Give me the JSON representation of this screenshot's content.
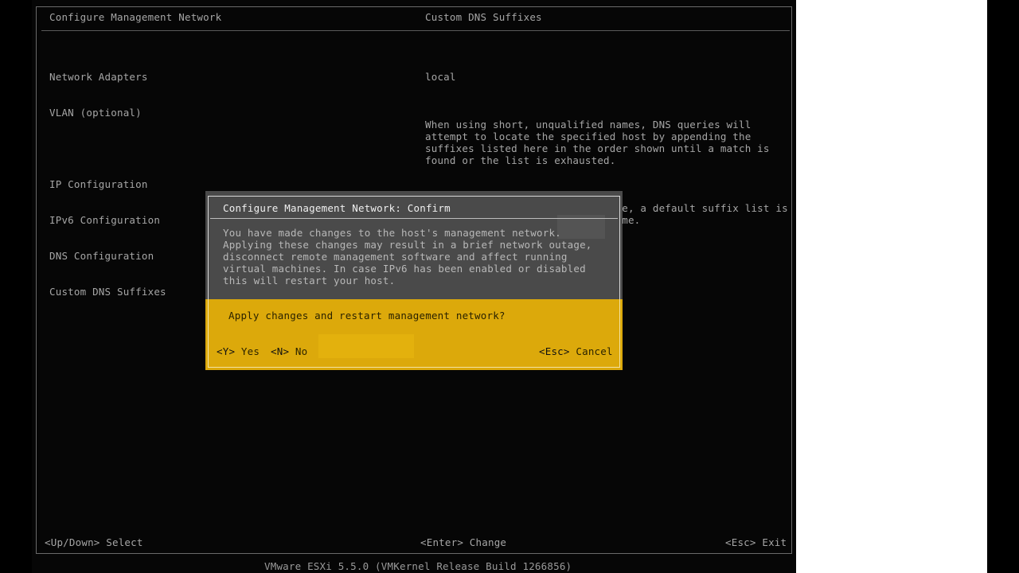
{
  "header": {
    "left_title": "Configure Management Network",
    "right_title": "Custom DNS Suffixes"
  },
  "menu": {
    "items": [
      "Network Adapters",
      "VLAN (optional)",
      "IP Configuration",
      "IPv6 Configuration",
      "DNS Configuration",
      "Custom DNS Suffixes"
    ]
  },
  "details": {
    "value": "local",
    "help_1": "When using short, unqualified names, DNS queries will attempt to locate the specified host by appending the suffixes listed here in the order shown until a match is found or the list is exhausted.",
    "help_2": "If no suffixes are specified here, a default suffix list is derived from the local domain name."
  },
  "dialog": {
    "title": "Configure Management Network: Confirm",
    "message": "You have made changes to the host's management network. Applying these changes may result in a brief network outage, disconnect remote management software and affect running virtual machines. In case IPv6 has been enabled or disabled this will restart your host.",
    "question": "Apply changes and restart management network?",
    "yes_key": "<Y>",
    "yes_label": "Yes",
    "no_key": "<N>",
    "no_label": "No",
    "cancel_key": "<Esc>",
    "cancel_label": "Cancel"
  },
  "footer": {
    "select": "<Up/Down> Select",
    "change": "<Enter> Change",
    "exit": "<Esc> Exit",
    "build": "VMware ESXi 5.5.0 (VMKernel Release Build 1266856)"
  },
  "colors": {
    "background": "#060606",
    "text": "#a6a6a6",
    "dialog_bg": "#4a4a4a",
    "accent_yellow": "#dca90b"
  }
}
